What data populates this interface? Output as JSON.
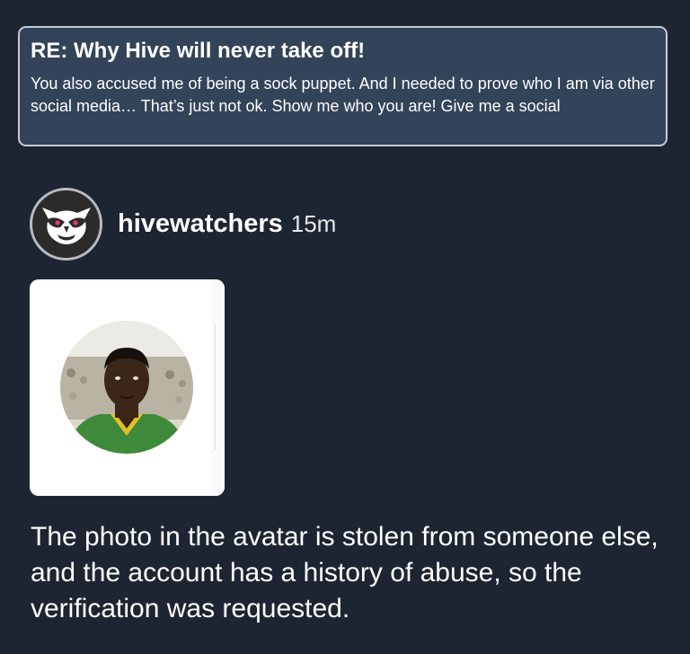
{
  "quoted_post": {
    "title": "RE: Why Hive will never take off!",
    "body": "You also accused me of being a sock puppet. And I needed to prove who I am via other social media… That’s just not ok. Show me who you are! Give me a social"
  },
  "post": {
    "username": "hivewatchers",
    "timestamp": "15m",
    "avatar_icon": "owl-logo-icon",
    "text": "The photo in the avatar is stolen from someone else, and the account has a history of abuse, so the verification was requested."
  },
  "colors": {
    "background": "#1d2532",
    "quote_card_background": "#334359",
    "quote_card_border": "#c7ccd3",
    "text": "#ffffff"
  }
}
